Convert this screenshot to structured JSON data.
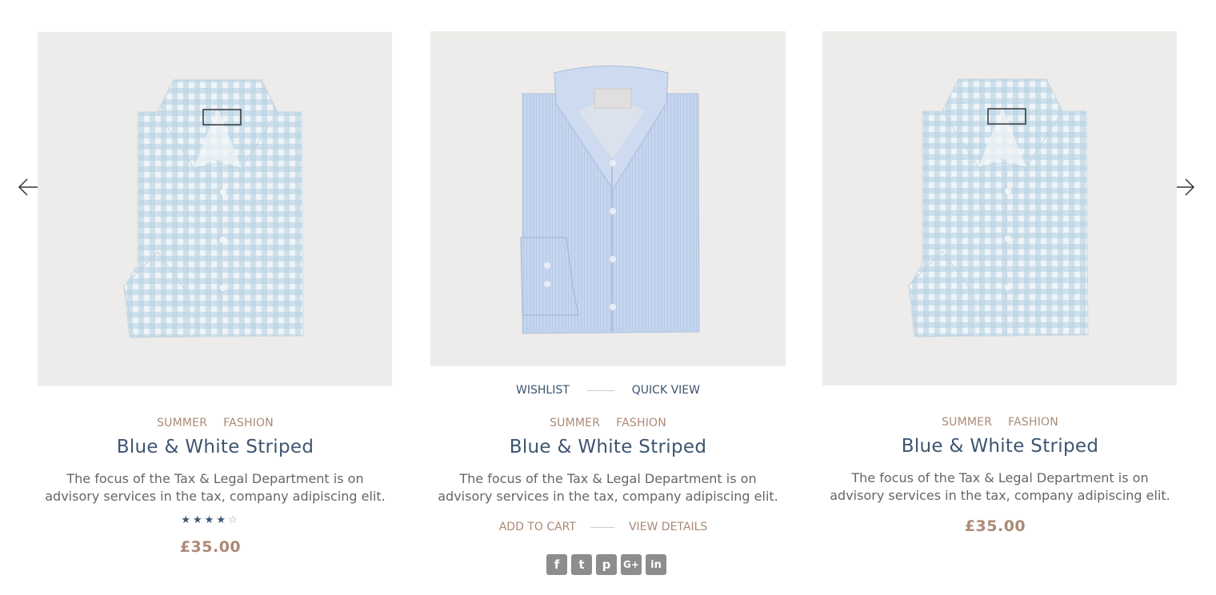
{
  "carousel": {
    "prev_icon": "arrow-left-icon",
    "next_icon": "arrow-right-icon"
  },
  "products": [
    {
      "categories": [
        "SUMMER",
        "FASHION"
      ],
      "title": "Blue & White Striped",
      "description_line1": "The focus of the Tax & Legal Department is on",
      "description_line2": "advisory services in the tax, company  adipiscing elit.",
      "rating": 4,
      "rating_max": 5,
      "price": "£35.00",
      "image": "gingham-shirt"
    },
    {
      "actions": {
        "wishlist": "WISHLIST",
        "quick_view": "QUICK VIEW"
      },
      "categories": [
        "SUMMER",
        "FASHION"
      ],
      "title": "Blue & White Striped",
      "description_line1": "The focus of the Tax & Legal Department is on",
      "description_line2": "advisory services in the tax, company  adipiscing elit.",
      "buttons": {
        "add_to_cart": "ADD TO CART",
        "view_details": "VIEW DETAILS"
      },
      "social": [
        {
          "icon": "facebook-icon",
          "glyph": "f"
        },
        {
          "icon": "twitter-icon",
          "glyph": "t"
        },
        {
          "icon": "pinterest-icon",
          "glyph": "p"
        },
        {
          "icon": "google-plus-icon",
          "glyph": "G+"
        },
        {
          "icon": "linkedin-icon",
          "glyph": "in"
        }
      ],
      "image": "striped-shirt"
    },
    {
      "categories": [
        "SUMMER",
        "FASHION"
      ],
      "title": "Blue & White Striped",
      "description_line1": "The focus of the Tax & Legal Department is on",
      "description_line2": "advisory services in the tax, company  adipiscing elit.",
      "price": "£35.00",
      "image": "gingham-shirt"
    }
  ],
  "colors": {
    "navy": "#3d5570",
    "tan": "#ab8a77",
    "image_bg": "#edecea"
  }
}
